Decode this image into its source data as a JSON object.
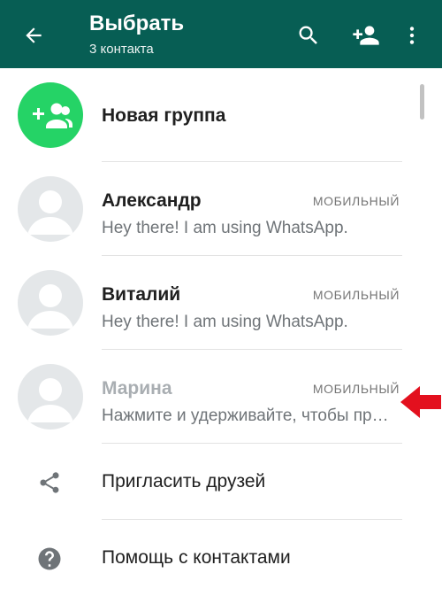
{
  "appbar": {
    "title": "Выбрать",
    "subtitle": "3 контакта",
    "back_icon": "arrow-left-icon",
    "search_icon": "search-icon",
    "add_contact_icon": "add-person-icon",
    "menu_icon": "more-vertical-icon",
    "color": "#075e54"
  },
  "new_group": {
    "label": "Новая группа",
    "icon": "group-add-icon",
    "color": "#25d366"
  },
  "contacts": [
    {
      "name": "Александр",
      "type": "МОБИЛЬНЫЙ",
      "status": "Hey there! I am using WhatsApp."
    },
    {
      "name": "Виталий",
      "type": "МОБИЛЬНЫЙ",
      "status": "Hey there! I am using WhatsApp."
    },
    {
      "name": "Марина",
      "type": "МОБИЛЬНЫЙ",
      "status": "Нажмите и удерживайте, чтобы пригласить"
    }
  ],
  "actions": [
    {
      "label": "Пригласить друзей",
      "icon": "share-icon"
    },
    {
      "label": "Помощь с контактами",
      "icon": "help-icon"
    }
  ],
  "annotation": {
    "icon": "red-arrow-icon",
    "color": "#e3101e"
  }
}
